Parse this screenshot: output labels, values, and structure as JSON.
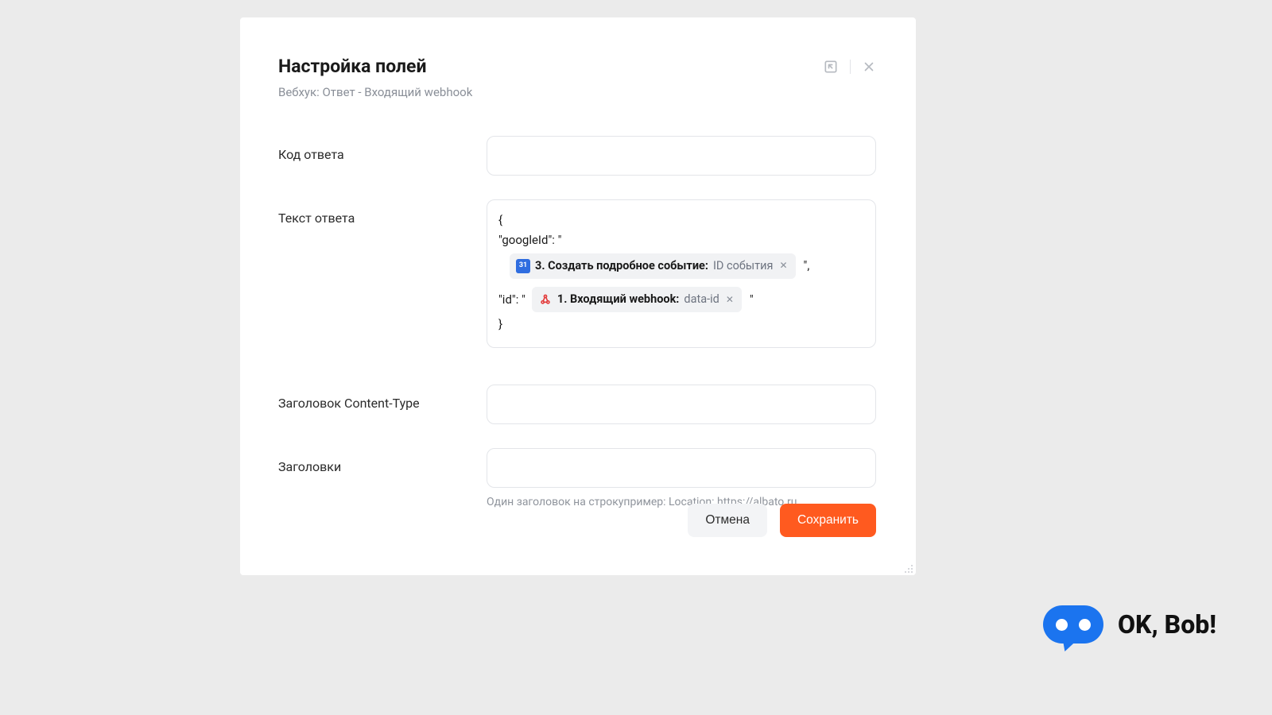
{
  "modal": {
    "title": "Настройка полей",
    "subtitle": "Вебхук: Ответ - Входящий webhook"
  },
  "fields": {
    "response_code": {
      "label": "Код ответа",
      "value": ""
    },
    "response_text": {
      "label": "Текст ответа",
      "body": {
        "open_brace": "{",
        "line1_prefix": "\"googleId\": \"",
        "token1_step": "3. Создать подробное событие:",
        "token1_field": "ID события",
        "line1_suffix": "\",",
        "line2_prefix": "\"id\": \"",
        "token2_step": "1. Входящий webhook:",
        "token2_field": "data-id",
        "line2_suffix": "\"",
        "close_brace": "}"
      }
    },
    "content_type": {
      "label": "Заголовок Content-Type",
      "value": ""
    },
    "headers": {
      "label": "Заголовки",
      "value": "",
      "hint": "Один заголовок на строкупример: Location: https://albato.ru"
    }
  },
  "buttons": {
    "cancel": "Отмена",
    "save": "Сохранить"
  },
  "brand": {
    "text": "OK, Bob!"
  }
}
